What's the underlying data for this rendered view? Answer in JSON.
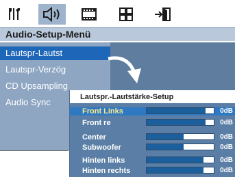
{
  "tabs": [
    {
      "id": "general",
      "icon": "tools-icon"
    },
    {
      "id": "audio",
      "icon": "speaker-icon",
      "active": true
    },
    {
      "id": "video",
      "icon": "film-icon"
    },
    {
      "id": "preferences",
      "icon": "grid-icon"
    },
    {
      "id": "exit",
      "icon": "exit-door-icon"
    }
  ],
  "menu": {
    "title": "Audio-Setup-Menü",
    "items": [
      {
        "label": "Lautspr-Lautst",
        "selected": true
      },
      {
        "label": "Lautspr-Verzög"
      },
      {
        "label": "CD Upsampling"
      },
      {
        "label": "Audio Sync"
      }
    ]
  },
  "popup": {
    "title": "Lautspr.-Lautstärke-Setup",
    "rows": [
      {
        "label": "Front Links",
        "level": 0.88,
        "value": "0dB",
        "highlighted": true
      },
      {
        "label": "Front re",
        "level": 0.88,
        "value": "0dB"
      },
      {
        "label": "Center",
        "level": 0.55,
        "value": "0dB"
      },
      {
        "label": "Subwoofer",
        "level": 0.55,
        "value": "0dB"
      },
      {
        "label": "Hinten links",
        "level": 0.85,
        "value": "0dB"
      },
      {
        "label": "Hinten rechts",
        "level": 0.85,
        "value": "0dB"
      }
    ]
  },
  "colors": {
    "selected_item": "#1e66b8",
    "list_bg": "#8ea6c2",
    "popup_bg": "#5a7ea5",
    "bar_fill": "#1b5f9c",
    "highlight_text": "#ffe98a"
  }
}
